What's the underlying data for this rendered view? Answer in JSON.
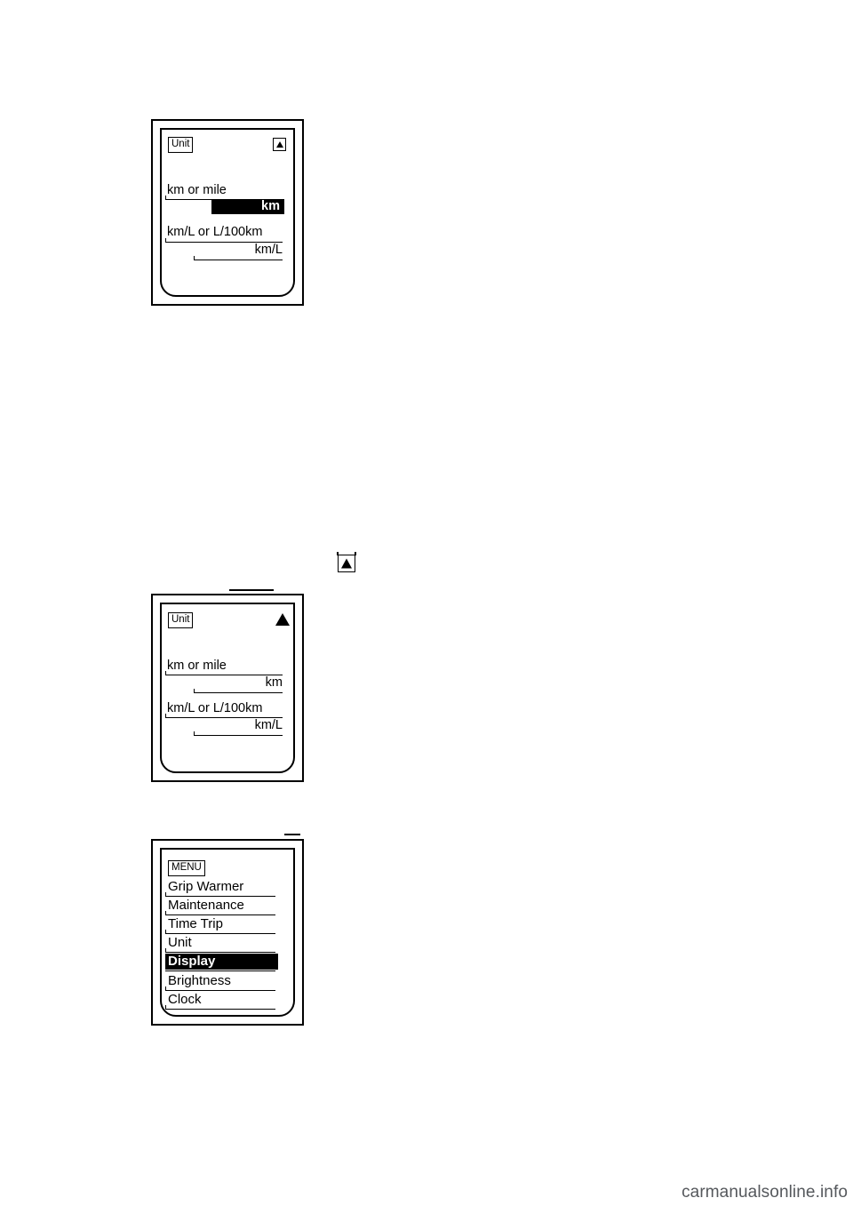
{
  "page": {
    "watermark": "carmanualsonline.info"
  },
  "figures": [
    {
      "id": "unit-screen-km-selected",
      "name": "Unit setting display with km highlighted",
      "chip": "Unit",
      "indicator_icon": "triangle-up-boxed-icon",
      "rows": [
        {
          "label": "km or mile",
          "value": "km",
          "highlighted": true
        },
        {
          "label": "km/L or L/100km",
          "value": "km/L",
          "highlighted": false
        }
      ]
    },
    {
      "id": "unit-screen-km-confirmed",
      "name": "Unit setting display with km confirmed",
      "chip": "Unit",
      "indicator_icon": "triangle-up-solid-icon",
      "rows": [
        {
          "label": "km or mile",
          "value": "km",
          "highlighted": false
        },
        {
          "label": "km/L or L/100km",
          "value": "km/L",
          "highlighted": false
        }
      ]
    },
    {
      "id": "menu-screen-display-selected",
      "name": "MENU list with Display highlighted",
      "chip": "MENU",
      "items": [
        {
          "label": "Grip Warmer",
          "selected": false
        },
        {
          "label": "Maintenance",
          "selected": false
        },
        {
          "label": "Time Trip",
          "selected": false
        },
        {
          "label": "Unit",
          "selected": false
        },
        {
          "label": "Display",
          "selected": true
        },
        {
          "label": "Brightness",
          "selected": false
        },
        {
          "label": "Clock",
          "selected": false
        }
      ]
    }
  ],
  "inline_symbol": {
    "name": "triangle-up-symbol-icon",
    "alt": "select arrow symbol"
  }
}
